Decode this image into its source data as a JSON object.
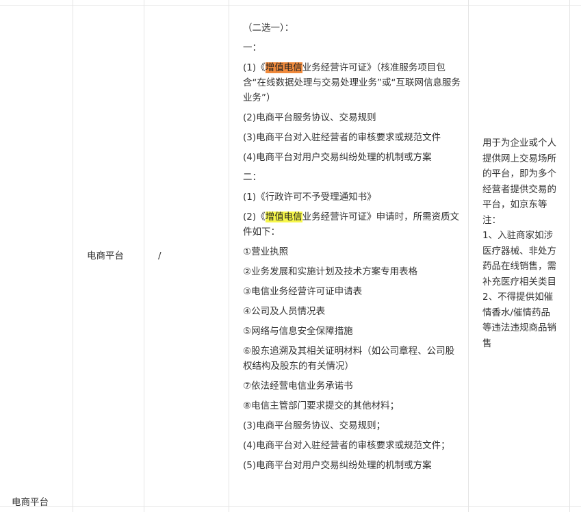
{
  "table": {
    "row_category": "电商平台",
    "business_type": "电商平台",
    "license_cell": "/",
    "requirements": {
      "intro": "（二选一）：",
      "option1_label": "一：",
      "item1": {
        "prefix": "(1)《",
        "highlight": "增值电信",
        "rest": "业务经营许可证》（核准服务项目包含“在线数据处理与交易处理业务”或“互联网信息服务业务”）"
      },
      "item2": "(2)电商平台服务协议、交易规则",
      "item3": "(3)电商平台对入驻经营者的审核要求或规范文件",
      "item4": "(4)电商平台对用户交易纠纷处理的机制或方案",
      "option2_label": "二：",
      "o2_item1": "(1)《行政许可不予受理通知书》",
      "o2_item2": {
        "prefix": "(2)《",
        "highlight": "增值电信",
        "rest": "业务经营许可证》申请时，所需资质文件如下："
      },
      "docs": [
        "①营业执照",
        "②业务发展和实施计划及技术方案专用表格",
        "③电信业务经营许可证申请表",
        "④公司及人员情况表",
        "⑤网络与信息安全保障措施",
        "⑥股东追溯及其相关证明材料（如公司章程、公司股权结构及股东的有关情况）",
        "⑦依法经营电信业务承诺书",
        "⑧电信主管部门要求提交的其他材料；"
      ],
      "o2_item3": "(3)电商平台服务协议、交易规则；",
      "o2_item4": "(4)电商平台对入驻经营者的审核要求或规范文件；",
      "o2_item5": "(5)电商平台对用户交易纠纷处理的机制或方案"
    },
    "remark": [
      "用于为企业或个人提供网上交易场所的平台，即为多个经营者提供交易的平台，如京东等",
      "注：",
      "1、入驻商家如涉医疗器械、非处方药品在线销售，需补充医疗相关类目",
      "2、不得提供如催情香水/催情药品等违法违规商品销售"
    ]
  },
  "colors": {
    "highlight_orange": "#f08a3c",
    "highlight_yellow": "#f6f64a",
    "border": "#e4e4e4",
    "text": "#333333"
  }
}
